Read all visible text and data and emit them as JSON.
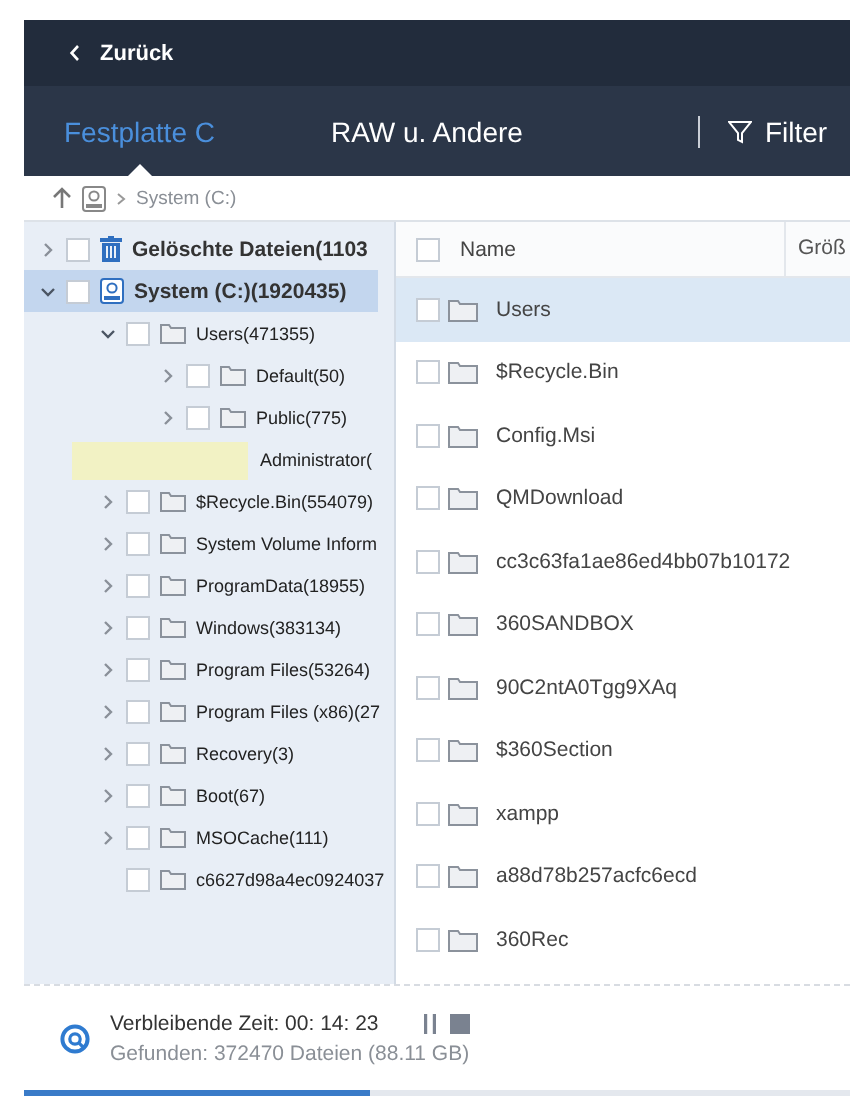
{
  "back_button": {
    "label": "Zurück"
  },
  "tabs": [
    {
      "label": "Festplatte C",
      "selected": true
    },
    {
      "label": "RAW u. Andere",
      "selected": false
    }
  ],
  "filter_button": {
    "label": "Filter"
  },
  "breadcrumb": {
    "path": "System (C:)"
  },
  "tree": [
    {
      "label": "Gelöschte Dateien(1103",
      "kind": "trash",
      "expanded": false,
      "checked": false,
      "selected": false
    },
    {
      "label": "System (C:)(1920435)",
      "kind": "drive",
      "expanded": true,
      "checked": false,
      "selected": true,
      "children": [
        {
          "label": "Users(471355)",
          "kind": "folder",
          "expanded": true,
          "checked": false,
          "selected": false,
          "children": [
            {
              "label": "Default(50)",
              "kind": "folder",
              "expanded": false,
              "checked": false,
              "selected": false
            },
            {
              "label": "Public(775)",
              "kind": "folder",
              "expanded": false,
              "checked": false,
              "selected": false
            },
            {
              "label": "Administrator(",
              "kind": "covered",
              "selected": false
            }
          ]
        },
        {
          "label": "$Recycle.Bin(554079)",
          "kind": "folder",
          "expanded": false,
          "checked": false,
          "selected": false
        },
        {
          "label": "System Volume Inform",
          "kind": "folder",
          "expanded": false,
          "checked": false,
          "selected": false
        },
        {
          "label": "ProgramData(18955)",
          "kind": "folder",
          "expanded": false,
          "checked": false,
          "selected": false
        },
        {
          "label": "Windows(383134)",
          "kind": "folder",
          "expanded": false,
          "checked": false,
          "selected": false
        },
        {
          "label": "Program Files(53264)",
          "kind": "folder",
          "expanded": false,
          "checked": false,
          "selected": false
        },
        {
          "label": "Program Files (x86)(27",
          "kind": "folder",
          "expanded": false,
          "checked": false,
          "selected": false
        },
        {
          "label": "Recovery(3)",
          "kind": "folder",
          "expanded": false,
          "checked": false,
          "selected": false
        },
        {
          "label": "Boot(67)",
          "kind": "folder",
          "expanded": false,
          "checked": false,
          "selected": false
        },
        {
          "label": "MSOCache(111)",
          "kind": "folder",
          "expanded": false,
          "checked": false,
          "selected": false
        },
        {
          "label": "c6627d98a4ec0924037",
          "kind": "folder",
          "checked": false,
          "selected": false
        }
      ]
    }
  ],
  "file_list": {
    "columns": [
      "Name",
      "Größ"
    ],
    "header_checked": false,
    "rows": [
      {
        "name": "Users",
        "checked": false,
        "selected": true
      },
      {
        "name": "$Recycle.Bin",
        "checked": false,
        "selected": false
      },
      {
        "name": "Config.Msi",
        "checked": false,
        "selected": false
      },
      {
        "name": "QMDownload",
        "checked": false,
        "selected": false
      },
      {
        "name": "cc3c63fa1ae86ed4bb07b10172",
        "checked": false,
        "selected": false
      },
      {
        "name": "360SANDBOX",
        "checked": false,
        "selected": false
      },
      {
        "name": "90C2ntA0Tgg9XAq",
        "checked": false,
        "selected": false
      },
      {
        "name": "$360Section",
        "checked": false,
        "selected": false
      },
      {
        "name": "xampp",
        "checked": false,
        "selected": false
      },
      {
        "name": "a88d78b257acfc6ecd",
        "checked": false,
        "selected": false
      },
      {
        "name": "360Rec",
        "checked": false,
        "selected": false
      }
    ]
  },
  "status": {
    "remaining": "Verbleibende Zeit: 00: 14: 23",
    "found": "Gefunden: 372470 Dateien (88.11 GB)",
    "level": 0.42
  }
}
